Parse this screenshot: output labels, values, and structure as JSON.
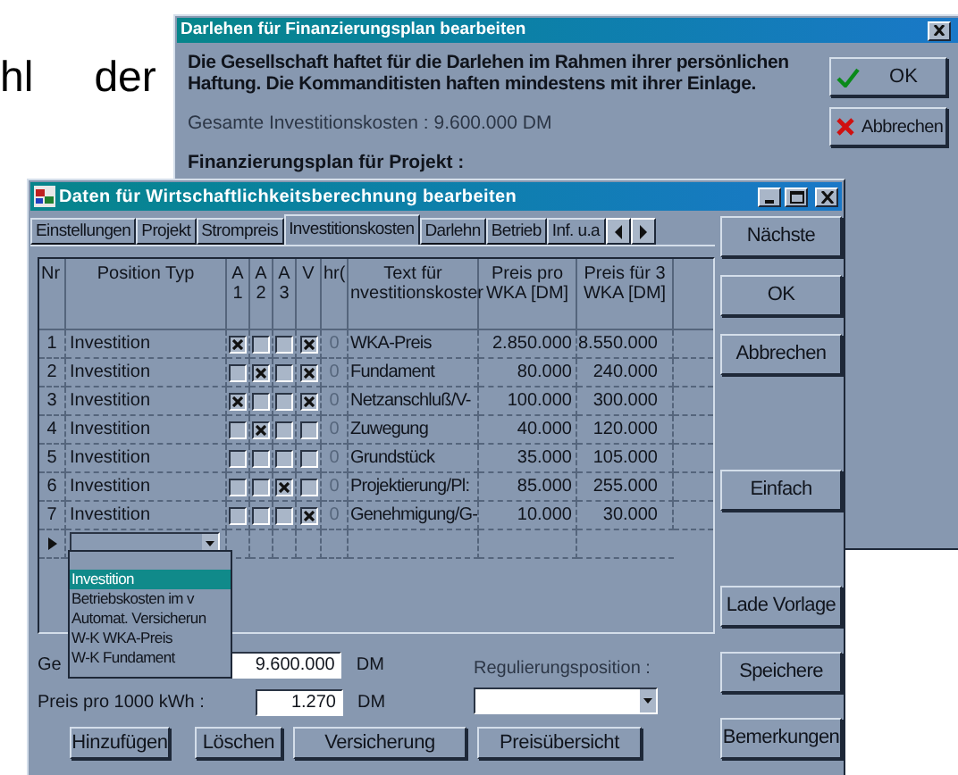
{
  "background_text": [
    "hl",
    "der"
  ],
  "loan_dialog": {
    "title": "Darlehen für Finanzierungsplan bearbeiten",
    "notice": "Die Gesellschaft haftet für die Darlehen im Rahmen ihrer persönlichen\nHaftung. Die Kommanditisten haften mindestens mit ihrer Einlage.",
    "total_costs": "Gesamte Investitionskosten : 9.600.000 DM",
    "plan_label": "Finanzierungsplan für Projekt :",
    "buttons": [
      {
        "label": "OK",
        "kind": "ok"
      },
      {
        "label": "Abbrechen",
        "kind": "cancel"
      }
    ]
  },
  "main_window": {
    "title": "Daten für Wirtschaftlichkeitsberechnung bearbeiten",
    "tabs": [
      {
        "label": "Einstellungen",
        "selected": false
      },
      {
        "label": "Projekt",
        "selected": false
      },
      {
        "label": "Strompreis",
        "selected": false
      },
      {
        "label": "Investitionskosten",
        "selected": true
      },
      {
        "label": "Darlehn",
        "selected": false
      },
      {
        "label": "Betrieb",
        "selected": false
      },
      {
        "label": "Inf. u.a",
        "selected": false
      }
    ],
    "columns": [
      "Nr",
      "Position Typ",
      "A\n1",
      "A\n2",
      "A\n3",
      "V",
      "hr(",
      "Text für\nnvestitionskoster",
      "Preis pro\nWKA [DM]",
      "Preis für 3\nWKA [DM]"
    ],
    "rows": [
      {
        "nr": "1",
        "type": "Investition",
        "checks": [
          true,
          false,
          false,
          true
        ],
        "hr": "0",
        "text": "WKA-Preis",
        "price_per_wka": "2.850.000",
        "price_3_wka": "8.550.000"
      },
      {
        "nr": "2",
        "type": "Investition",
        "checks": [
          false,
          true,
          false,
          true
        ],
        "hr": "0",
        "text": "Fundament",
        "price_per_wka": "80.000",
        "price_3_wka": "240.000"
      },
      {
        "nr": "3",
        "type": "Investition",
        "checks": [
          true,
          false,
          false,
          true
        ],
        "hr": "0",
        "text": "Netzanschluß/V-",
        "price_per_wka": "100.000",
        "price_3_wka": "300.000"
      },
      {
        "nr": "4",
        "type": "Investition",
        "checks": [
          false,
          true,
          false,
          false
        ],
        "hr": "0",
        "text": "Zuwegung",
        "price_per_wka": "40.000",
        "price_3_wka": "120.000"
      },
      {
        "nr": "5",
        "type": "Investition",
        "checks": [
          false,
          false,
          false,
          false
        ],
        "hr": "0",
        "text": "Grundstück",
        "price_per_wka": "35.000",
        "price_3_wka": "105.000"
      },
      {
        "nr": "6",
        "type": "Investition",
        "checks": [
          false,
          false,
          true,
          false
        ],
        "hr": "0",
        "text": "Projektierung/Pl:",
        "price_per_wka": "85.000",
        "price_3_wka": "255.000"
      },
      {
        "nr": "7",
        "type": "Investition",
        "checks": [
          false,
          false,
          false,
          true
        ],
        "hr": "0",
        "text": "Genehmigung/G-",
        "price_per_wka": "10.000",
        "price_3_wka": "30.000"
      }
    ],
    "dropdown_items": [
      {
        "label": "Investition",
        "selected": true
      },
      {
        "label": "Betriebskosten im v",
        "selected": false
      },
      {
        "label": "Automat. Versicherun",
        "selected": false
      },
      {
        "label": "W-K WKA-Preis",
        "selected": false
      },
      {
        "label": "W-K Fundament",
        "selected": false
      }
    ],
    "total_label": "Ge",
    "total_value": "9.600.000",
    "total_unit": "DM",
    "price_label": "Preis pro 1000 kWh :",
    "price_value": "1.270",
    "price_unit": "DM",
    "regulation_label": "Regulierungsposition :",
    "bottom_buttons": [
      "Hinzufügen",
      "Löschen",
      "Versicherung",
      "Preisübersicht"
    ],
    "side_buttons": [
      "Nächste",
      "OK",
      "Abbrechen",
      "Einfach",
      "Lade Vorlage",
      "Speichere",
      "Bemerkungen"
    ]
  }
}
